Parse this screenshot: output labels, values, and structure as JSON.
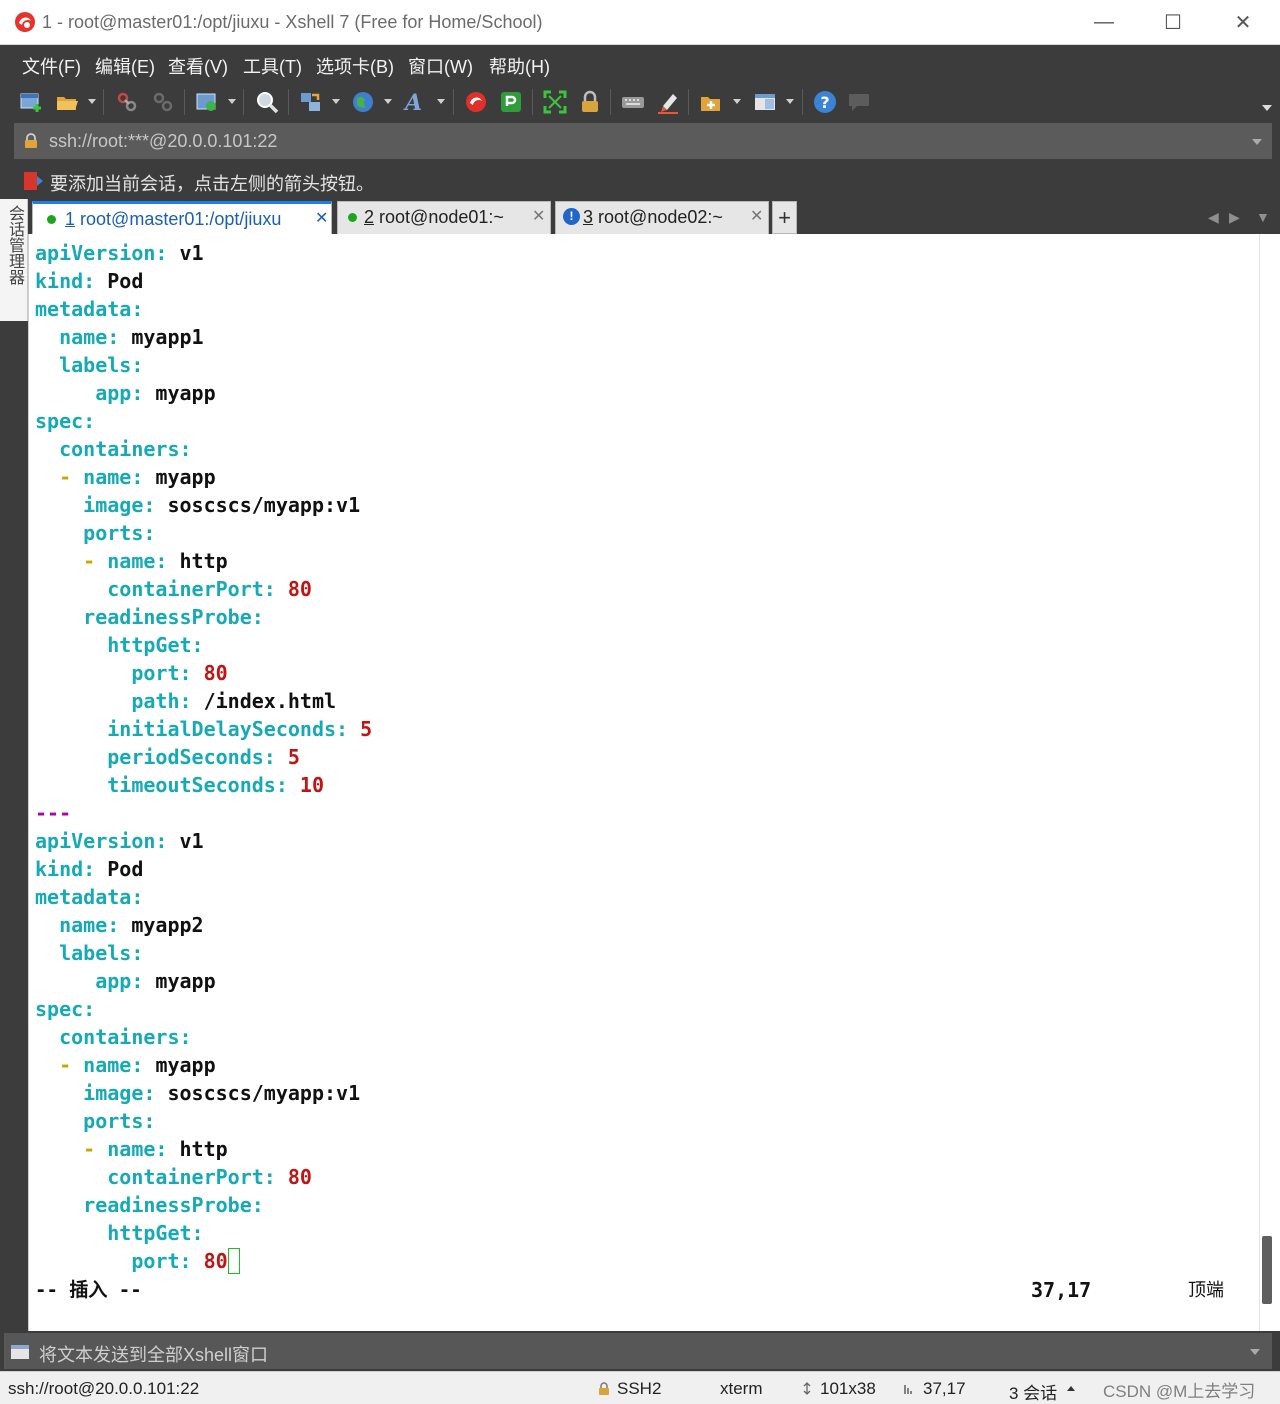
{
  "window": {
    "title": "1 - root@master01:/opt/jiuxu - Xshell 7 (Free for Home/School)",
    "controls": {
      "minimize": "—",
      "maximize": "☐",
      "close": "✕"
    }
  },
  "menu": [
    "文件(F)",
    "编辑(E)",
    "查看(V)",
    "工具(T)",
    "选项卡(B)",
    "窗口(W)",
    "帮助(H)"
  ],
  "toolbar_icons": [
    "new-session-icon",
    "open-folder-icon",
    "reconnect-icon",
    "disconnect-icon",
    "properties-icon",
    "find-icon",
    "transfer-icon",
    "globe-icon",
    "font-icon",
    "xftp-icon",
    "xagent-icon",
    "fullscreen-icon",
    "lock-icon",
    "keyboard-icon",
    "highlight-icon",
    "new-tab-icon",
    "layout-icon",
    "help-icon",
    "chat-icon"
  ],
  "address": {
    "value": "ssh://root:***@20.0.0.101:22"
  },
  "hint": {
    "text": "要添加当前会话，点击左侧的箭头按钮。"
  },
  "side_panel": {
    "label": "会话管理器"
  },
  "tabs": [
    {
      "number": "1",
      "label": "root@master01:/opt/jiuxu",
      "status": "connected",
      "active": true,
      "close": "✕"
    },
    {
      "number": "2",
      "label": "root@node01:~",
      "status": "connected",
      "active": false,
      "close": "✕"
    },
    {
      "number": "3",
      "label": "root@node02:~",
      "status": "alert",
      "active": false,
      "close": "✕"
    }
  ],
  "tab_add": "+",
  "tab_alert_mark": "!",
  "tab_nav": {
    "prev": "◀",
    "next": "▶",
    "menu": "▼"
  },
  "terminal": {
    "lines": [
      [
        {
          "t": "apiVersion",
          "c": "k"
        },
        {
          "t": ": ",
          "c": "k"
        },
        {
          "t": "v1",
          "c": "v"
        }
      ],
      [
        {
          "t": "kind",
          "c": "k"
        },
        {
          "t": ": ",
          "c": "k"
        },
        {
          "t": "Pod",
          "c": "v"
        }
      ],
      [
        {
          "t": "metadata",
          "c": "k"
        },
        {
          "t": ":",
          "c": "k"
        }
      ],
      [
        {
          "t": "  name",
          "c": "k"
        },
        {
          "t": ": ",
          "c": "k"
        },
        {
          "t": "myapp1",
          "c": "v"
        }
      ],
      [
        {
          "t": "  labels",
          "c": "k"
        },
        {
          "t": ":",
          "c": "k"
        }
      ],
      [
        {
          "t": "     app",
          "c": "k"
        },
        {
          "t": ": ",
          "c": "k"
        },
        {
          "t": "myapp",
          "c": "v"
        }
      ],
      [
        {
          "t": "spec",
          "c": "k"
        },
        {
          "t": ":",
          "c": "k"
        }
      ],
      [
        {
          "t": "  containers",
          "c": "k"
        },
        {
          "t": ":",
          "c": "k"
        }
      ],
      [
        {
          "t": "  - ",
          "c": "d"
        },
        {
          "t": "name",
          "c": "k"
        },
        {
          "t": ": ",
          "c": "k"
        },
        {
          "t": "myapp",
          "c": "v"
        }
      ],
      [
        {
          "t": "    image",
          "c": "k"
        },
        {
          "t": ": ",
          "c": "k"
        },
        {
          "t": "soscscs/myapp:v1",
          "c": "v"
        }
      ],
      [
        {
          "t": "    ports",
          "c": "k"
        },
        {
          "t": ":",
          "c": "k"
        }
      ],
      [
        {
          "t": "    - ",
          "c": "d"
        },
        {
          "t": "name",
          "c": "k"
        },
        {
          "t": ": ",
          "c": "k"
        },
        {
          "t": "http",
          "c": "v"
        }
      ],
      [
        {
          "t": "      containerPort",
          "c": "k"
        },
        {
          "t": ": ",
          "c": "k"
        },
        {
          "t": "80",
          "c": "n"
        }
      ],
      [
        {
          "t": "    readinessProbe",
          "c": "k"
        },
        {
          "t": ":",
          "c": "k"
        }
      ],
      [
        {
          "t": "      httpGet",
          "c": "k"
        },
        {
          "t": ":",
          "c": "k"
        }
      ],
      [
        {
          "t": "        port",
          "c": "k"
        },
        {
          "t": ": ",
          "c": "k"
        },
        {
          "t": "80",
          "c": "n"
        }
      ],
      [
        {
          "t": "        path",
          "c": "k"
        },
        {
          "t": ": ",
          "c": "k"
        },
        {
          "t": "/index.html",
          "c": "v"
        }
      ],
      [
        {
          "t": "      initialDelaySeconds",
          "c": "k"
        },
        {
          "t": ": ",
          "c": "k"
        },
        {
          "t": "5",
          "c": "n"
        }
      ],
      [
        {
          "t": "      periodSeconds",
          "c": "k"
        },
        {
          "t": ": ",
          "c": "k"
        },
        {
          "t": "5",
          "c": "n"
        }
      ],
      [
        {
          "t": "      timeoutSeconds",
          "c": "k"
        },
        {
          "t": ": ",
          "c": "k"
        },
        {
          "t": "10",
          "c": "n"
        }
      ],
      [
        {
          "t": "---",
          "c": "s"
        }
      ],
      [
        {
          "t": "apiVersion",
          "c": "k"
        },
        {
          "t": ": ",
          "c": "k"
        },
        {
          "t": "v1",
          "c": "v"
        }
      ],
      [
        {
          "t": "kind",
          "c": "k"
        },
        {
          "t": ": ",
          "c": "k"
        },
        {
          "t": "Pod",
          "c": "v"
        }
      ],
      [
        {
          "t": "metadata",
          "c": "k"
        },
        {
          "t": ":",
          "c": "k"
        }
      ],
      [
        {
          "t": "  name",
          "c": "k"
        },
        {
          "t": ": ",
          "c": "k"
        },
        {
          "t": "myapp2",
          "c": "v"
        }
      ],
      [
        {
          "t": "  labels",
          "c": "k"
        },
        {
          "t": ":",
          "c": "k"
        }
      ],
      [
        {
          "t": "     app",
          "c": "k"
        },
        {
          "t": ": ",
          "c": "k"
        },
        {
          "t": "myapp",
          "c": "v"
        }
      ],
      [
        {
          "t": "spec",
          "c": "k"
        },
        {
          "t": ":",
          "c": "k"
        }
      ],
      [
        {
          "t": "  containers",
          "c": "k"
        },
        {
          "t": ":",
          "c": "k"
        }
      ],
      [
        {
          "t": "  - ",
          "c": "d"
        },
        {
          "t": "name",
          "c": "k"
        },
        {
          "t": ": ",
          "c": "k"
        },
        {
          "t": "myapp",
          "c": "v"
        }
      ],
      [
        {
          "t": "    image",
          "c": "k"
        },
        {
          "t": ": ",
          "c": "k"
        },
        {
          "t": "soscscs/myapp:v1",
          "c": "v"
        }
      ],
      [
        {
          "t": "    ports",
          "c": "k"
        },
        {
          "t": ":",
          "c": "k"
        }
      ],
      [
        {
          "t": "    - ",
          "c": "d"
        },
        {
          "t": "name",
          "c": "k"
        },
        {
          "t": ": ",
          "c": "k"
        },
        {
          "t": "http",
          "c": "v"
        }
      ],
      [
        {
          "t": "      containerPort",
          "c": "k"
        },
        {
          "t": ": ",
          "c": "k"
        },
        {
          "t": "80",
          "c": "n"
        }
      ],
      [
        {
          "t": "    readinessProbe",
          "c": "k"
        },
        {
          "t": ":",
          "c": "k"
        }
      ],
      [
        {
          "t": "      httpGet",
          "c": "k"
        },
        {
          "t": ":",
          "c": "k"
        }
      ],
      [
        {
          "t": "        port",
          "c": "k"
        },
        {
          "t": ": ",
          "c": "k"
        },
        {
          "t": "80",
          "c": "n"
        },
        {
          "t": "",
          "c": "cursor"
        }
      ]
    ],
    "mode": "-- 插入 --",
    "position": "37,17",
    "scroll": "顶端"
  },
  "compose": {
    "placeholder": "将文本发送到全部Xshell窗口"
  },
  "statusbar": {
    "connection": "ssh://root@20.0.0.101:22",
    "protocol": "SSH2",
    "terminal": "xterm",
    "size": "101x38",
    "cursor": "37,17",
    "sessions": "3 会话",
    "watermark": "CSDN @M上去学习"
  },
  "colors": {
    "key": "#17a9b5",
    "value": "#111111",
    "number": "#c01515",
    "dash": "#c8a800",
    "separator": "#b000b0",
    "chrome_dark": "#3c3c3c",
    "tab_accent": "#1e7fdc"
  }
}
